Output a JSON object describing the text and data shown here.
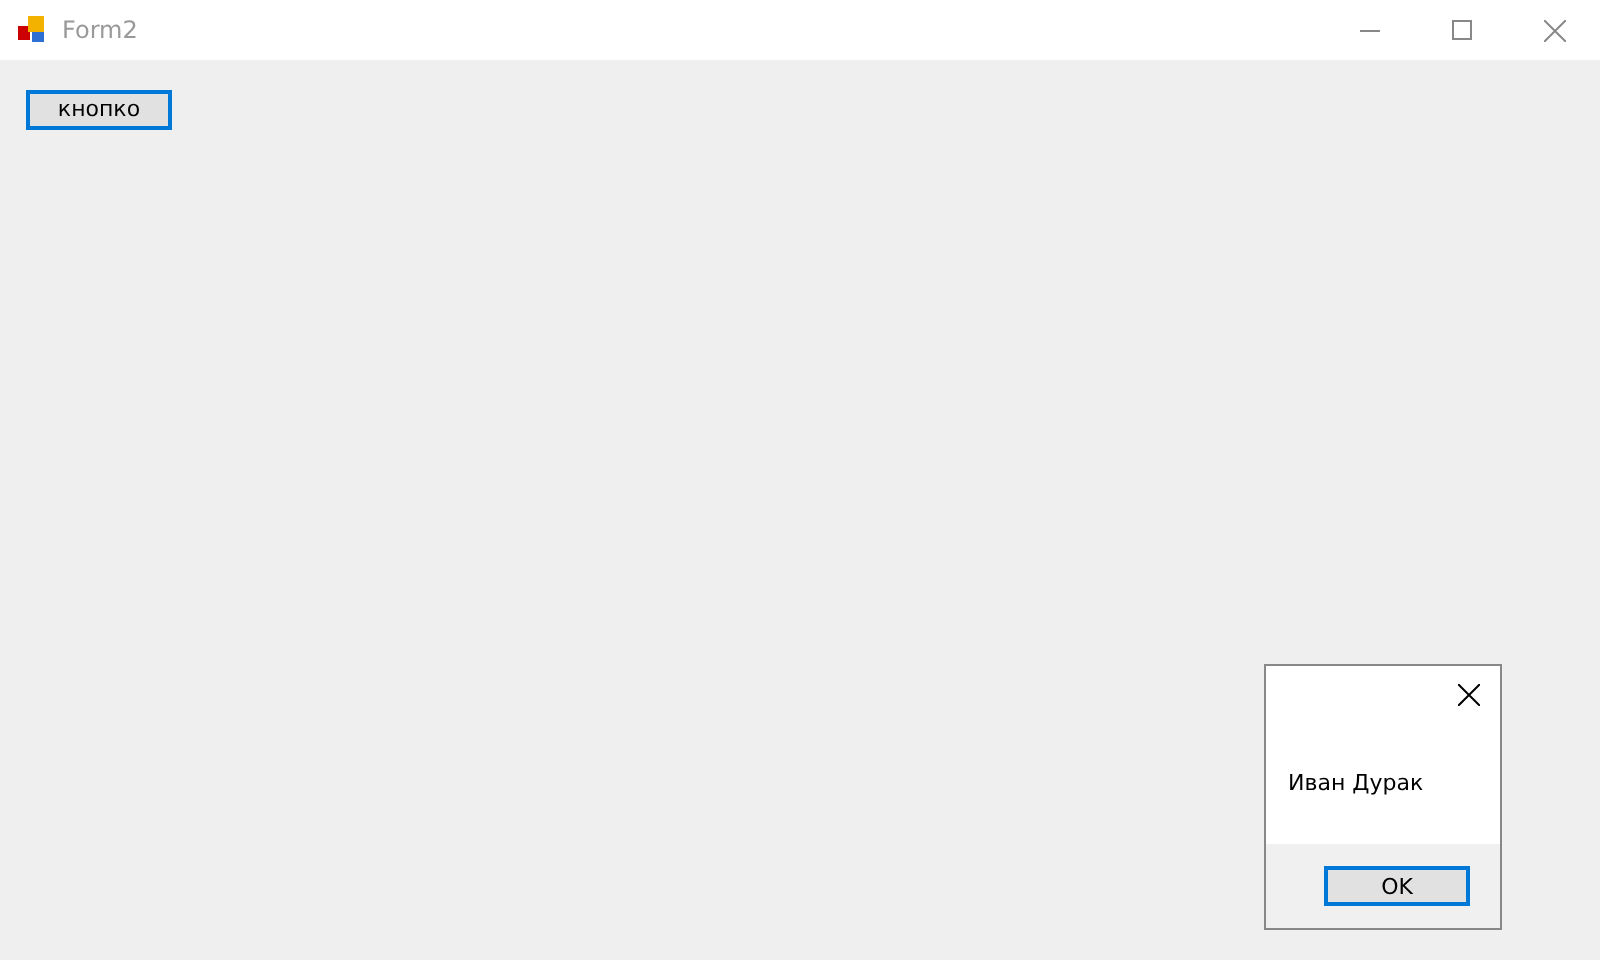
{
  "window": {
    "title": "Form2",
    "active": false
  },
  "button": {
    "label": "кнопко"
  },
  "message_box": {
    "text": "Иван Дурак",
    "button": "OK"
  }
}
